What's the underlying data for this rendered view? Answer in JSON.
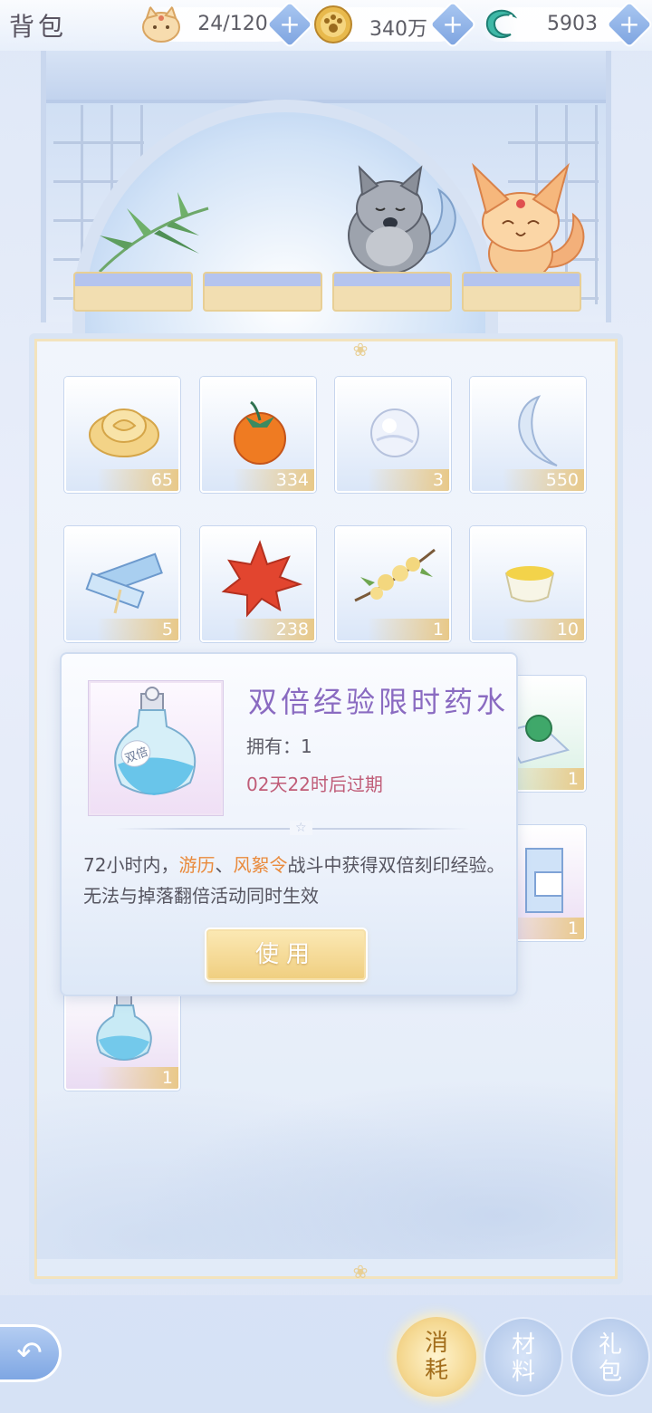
{
  "header": {
    "title": "背包",
    "resources": [
      {
        "icon": "cat-face-icon",
        "value": "24/120"
      },
      {
        "icon": "gold-coin-icon",
        "value": "340万"
      },
      {
        "icon": "jade-dragon-icon",
        "value": "5903"
      }
    ],
    "plus_label": "+"
  },
  "display": {
    "pets": [
      "gray-wolf-pet",
      "orange-fox-pet"
    ]
  },
  "items": [
    {
      "name": "golden-flower-item",
      "count": "65"
    },
    {
      "name": "persimmon-item",
      "count": "334"
    },
    {
      "name": "pearl-item",
      "count": "3"
    },
    {
      "name": "crystal-moon-item",
      "count": "550"
    },
    {
      "name": "scroll-item",
      "count": "5"
    },
    {
      "name": "maple-leaf-item",
      "count": "238"
    },
    {
      "name": "osmanthus-item",
      "count": "1"
    },
    {
      "name": "tea-cup-item",
      "count": "10"
    },
    {
      "name": "jade-bead-cloth-item",
      "count": "1"
    },
    {
      "name": "gift-box-item",
      "count": "1"
    },
    {
      "name": "double-exp-potion-item",
      "count": "1"
    }
  ],
  "popup": {
    "item_name": "双倍经验限时药水",
    "own_text": "拥有：1",
    "expire_text": "02天22时后过期",
    "desc_part1": "72小时内，",
    "desc_hl1": "游历",
    "desc_sep": "、",
    "desc_hl2": "风絮令",
    "desc_part2": "战斗中获得双倍刻印经验。无法与掉落翻倍活动同时生效",
    "use_label": "使用",
    "potion_label": "双倍"
  },
  "bottom": {
    "back_icon": "back-arrow-icon",
    "tabs": [
      {
        "label_top": "消",
        "label_bottom": "耗",
        "active": true
      },
      {
        "label_top": "材",
        "label_bottom": "料",
        "active": false
      },
      {
        "label_top": "礼",
        "label_bottom": "包",
        "active": false
      }
    ]
  },
  "colors": {
    "accent_purple": "#8a6bc1",
    "expire_red": "#c05d78",
    "highlight_orange": "#e98a3c",
    "gold": "#f0cf81"
  }
}
